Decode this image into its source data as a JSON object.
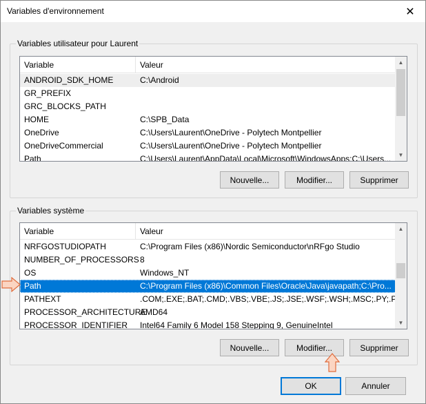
{
  "window": {
    "title": "Variables d'environnement",
    "close_glyph": "✕"
  },
  "user_group": {
    "label": "Variables utilisateur pour Laurent",
    "col_variable": "Variable",
    "col_value": "Valeur",
    "rows": [
      {
        "name": "ANDROID_SDK_HOME",
        "value": "C:\\Android"
      },
      {
        "name": "GR_PREFIX",
        "value": ""
      },
      {
        "name": "GRC_BLOCKS_PATH",
        "value": ""
      },
      {
        "name": "HOME",
        "value": "C:\\SPB_Data"
      },
      {
        "name": "OneDrive",
        "value": "C:\\Users\\Laurent\\OneDrive - Polytech Montpellier"
      },
      {
        "name": "OneDriveCommercial",
        "value": "C:\\Users\\Laurent\\OneDrive - Polytech Montpellier"
      },
      {
        "name": "Path",
        "value": "C:\\Users\\Laurent\\AppData\\Local\\Microsoft\\WindowsApps;C:\\Users..."
      }
    ],
    "buttons": {
      "new": "Nouvelle...",
      "edit": "Modifier...",
      "delete": "Supprimer"
    }
  },
  "system_group": {
    "label": "Variables système",
    "col_variable": "Variable",
    "col_value": "Valeur",
    "rows": [
      {
        "name": "NRFGOSTUDIOPATH",
        "value": "C:\\Program Files (x86)\\Nordic Semiconductor\\nRFgo Studio"
      },
      {
        "name": "NUMBER_OF_PROCESSORS",
        "value": "8"
      },
      {
        "name": "OS",
        "value": "Windows_NT"
      },
      {
        "name": "Path",
        "value": "C:\\Program Files (x86)\\Common Files\\Oracle\\Java\\javapath;C:\\Pro..."
      },
      {
        "name": "PATHEXT",
        "value": ".COM;.EXE;.BAT;.CMD;.VBS;.VBE;.JS;.JSE;.WSF;.WSH;.MSC;.PY;.PYW"
      },
      {
        "name": "PROCESSOR_ARCHITECTURE",
        "value": "AMD64"
      },
      {
        "name": "PROCESSOR_IDENTIFIER",
        "value": "Intel64 Family 6 Model 158 Stepping 9, GenuineIntel"
      }
    ],
    "buttons": {
      "new": "Nouvelle...",
      "edit": "Modifier...",
      "delete": "Supprimer"
    }
  },
  "dialog_buttons": {
    "ok": "OK",
    "cancel": "Annuler"
  },
  "colors": {
    "selection": "#0078d7",
    "arrow_fill": "#fbd5c2",
    "arrow_stroke": "#e06c3c"
  }
}
